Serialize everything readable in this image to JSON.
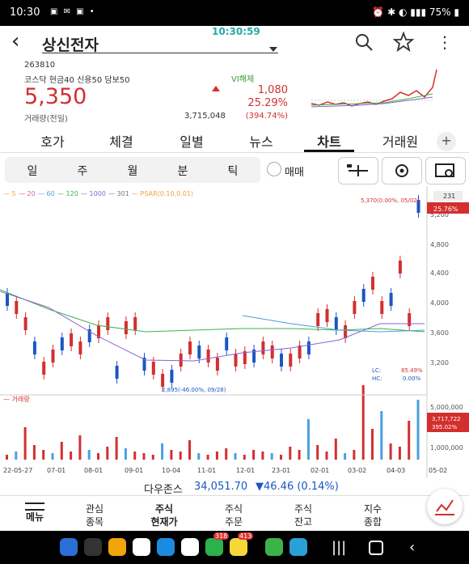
{
  "status_bar": {
    "time": "10:30",
    "right": "75%"
  },
  "clock": "10:30:59",
  "stock": {
    "name": "상신전자",
    "code": "263810",
    "tags": "코스닥 현금40 신용50 담보50",
    "price": "5,350",
    "vi": "VI해제",
    "change": "1,080",
    "rate": "25.29%",
    "volume_label": "거래량(전일)",
    "volume_value": "3,715,048",
    "volume_ratio": "(394.74%)"
  },
  "tabs": [
    "호가",
    "체결",
    "일별",
    "뉴스",
    "차트",
    "거래원"
  ],
  "active_tab": "차트",
  "periods": [
    "일",
    "주",
    "월",
    "분",
    "틱"
  ],
  "trade_label": "매매",
  "chart": {
    "legend": [
      "5",
      "20",
      "60",
      "120",
      "1000",
      "301",
      "PSAR(0.10,0.01)"
    ],
    "legend_colors": [
      "#f5a623",
      "#e05a9a",
      "#4aa0e0",
      "#3bb34a",
      "#8a63d2",
      "#7a7a7a",
      "#f0a040"
    ],
    "price_axis": [
      "5,200",
      "4,800",
      "4,400",
      "4,000",
      "3,600",
      "3,200"
    ],
    "last_price_tag": "25.76%",
    "top_tag": "231",
    "high_label": "5,370(0.00%, 05/02)",
    "low_label": "2,895(-46.00%, 09/28)",
    "lc_label": "LC:",
    "lc_value": "85.49%",
    "hc_label": "HC:",
    "hc_value": "0.00%",
    "volume_title": "거래량",
    "volume_axis": [
      "5,000,000",
      "1,000,000"
    ],
    "volume_tag_1": "3,717,722",
    "volume_tag_2": "395.02%",
    "date_axis": [
      "22-05-27",
      "07-01",
      "08-01",
      "09-01",
      "10-04",
      "11-01",
      "12-01",
      "23-01",
      "02-01",
      "03-02",
      "04-03",
      "05-02"
    ]
  },
  "index": {
    "name": "다우존스",
    "value": "34,051.70",
    "change": "▼46.46 (0.14%)"
  },
  "bottom_nav": [
    {
      "line1": "메뉴",
      "line2": ""
    },
    {
      "line1": "관심",
      "line2": "종목"
    },
    {
      "line1": "주식",
      "line2": "현재가"
    },
    {
      "line1": "주식",
      "line2": "주문"
    },
    {
      "line1": "주식",
      "line2": "잔고"
    },
    {
      "line1": "지수",
      "line2": "종합"
    }
  ],
  "app_badges": {
    "b1": "318",
    "b2": "413"
  }
}
